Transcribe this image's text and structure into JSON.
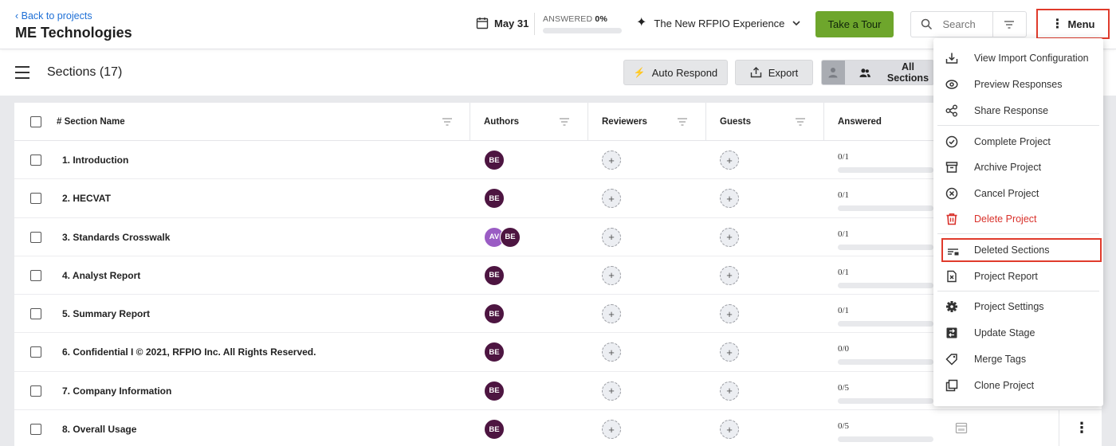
{
  "header": {
    "back_label": "Back to projects",
    "project_title": "ME Technologies",
    "due_date": "May 31",
    "answered_label": "ANSWERED",
    "answered_value": "0%",
    "answered_fraction": 0,
    "experience_label": "The New RFPIO Experience",
    "tour_label": "Take a Tour",
    "search_placeholder": "Search",
    "menu_label": "Menu"
  },
  "toolbar": {
    "sections_title": "Sections (17)",
    "auto_respond_label": "Auto Respond",
    "export_label": "Export",
    "all_sections_label": "All Sections"
  },
  "table": {
    "columns": [
      "# Section Name",
      "Authors",
      "Reviewers",
      "Guests",
      "Answered"
    ],
    "rows": [
      {
        "name": "1. Introduction",
        "authors": [
          "BE"
        ],
        "answered": "0/1"
      },
      {
        "name": "2. HECVAT",
        "authors": [
          "BE"
        ],
        "answered": "0/1"
      },
      {
        "name": "3. Standards Crosswalk",
        "authors": [
          "AV",
          "BE"
        ],
        "answered": "0/1"
      },
      {
        "name": "4. Analyst Report",
        "authors": [
          "BE"
        ],
        "answered": "0/1"
      },
      {
        "name": "5. Summary Report",
        "authors": [
          "BE"
        ],
        "answered": "0/1"
      },
      {
        "name": "6. Confidential I © 2021, RFPIO Inc. All Rights Reserved.",
        "authors": [
          "BE"
        ],
        "answered": "0/0"
      },
      {
        "name": "7. Company Information",
        "authors": [
          "BE"
        ],
        "answered": "0/5"
      },
      {
        "name": "8. Overall Usage",
        "authors": [
          "BE"
        ],
        "answered": "0/5"
      }
    ]
  },
  "menu": {
    "items": [
      {
        "label": "View Import Configuration",
        "icon": "import-icon"
      },
      {
        "label": "Preview Responses",
        "icon": "eye-icon"
      },
      {
        "label": "Share Response",
        "icon": "share-icon"
      },
      {
        "label": "Complete Project",
        "icon": "check-circle-icon"
      },
      {
        "label": "Archive Project",
        "icon": "archive-icon"
      },
      {
        "label": "Cancel Project",
        "icon": "x-circle-icon"
      },
      {
        "label": "Delete Project",
        "icon": "trash-icon"
      },
      {
        "label": "Deleted Sections",
        "icon": "deleted-sections-icon"
      },
      {
        "label": "Project Report",
        "icon": "report-icon"
      },
      {
        "label": "Project Settings",
        "icon": "gear-icon"
      },
      {
        "label": "Update Stage",
        "icon": "stage-icon"
      },
      {
        "label": "Merge Tags",
        "icon": "tag-icon"
      },
      {
        "label": "Clone Project",
        "icon": "clone-icon"
      }
    ]
  },
  "colors": {
    "accent_green": "#6ea62c",
    "highlight_red": "#e03b2c",
    "danger_red": "#d9312b",
    "link_blue": "#1d6fd6",
    "avatar_be": "#4d1541",
    "avatar_av": "#9a5cc4"
  }
}
